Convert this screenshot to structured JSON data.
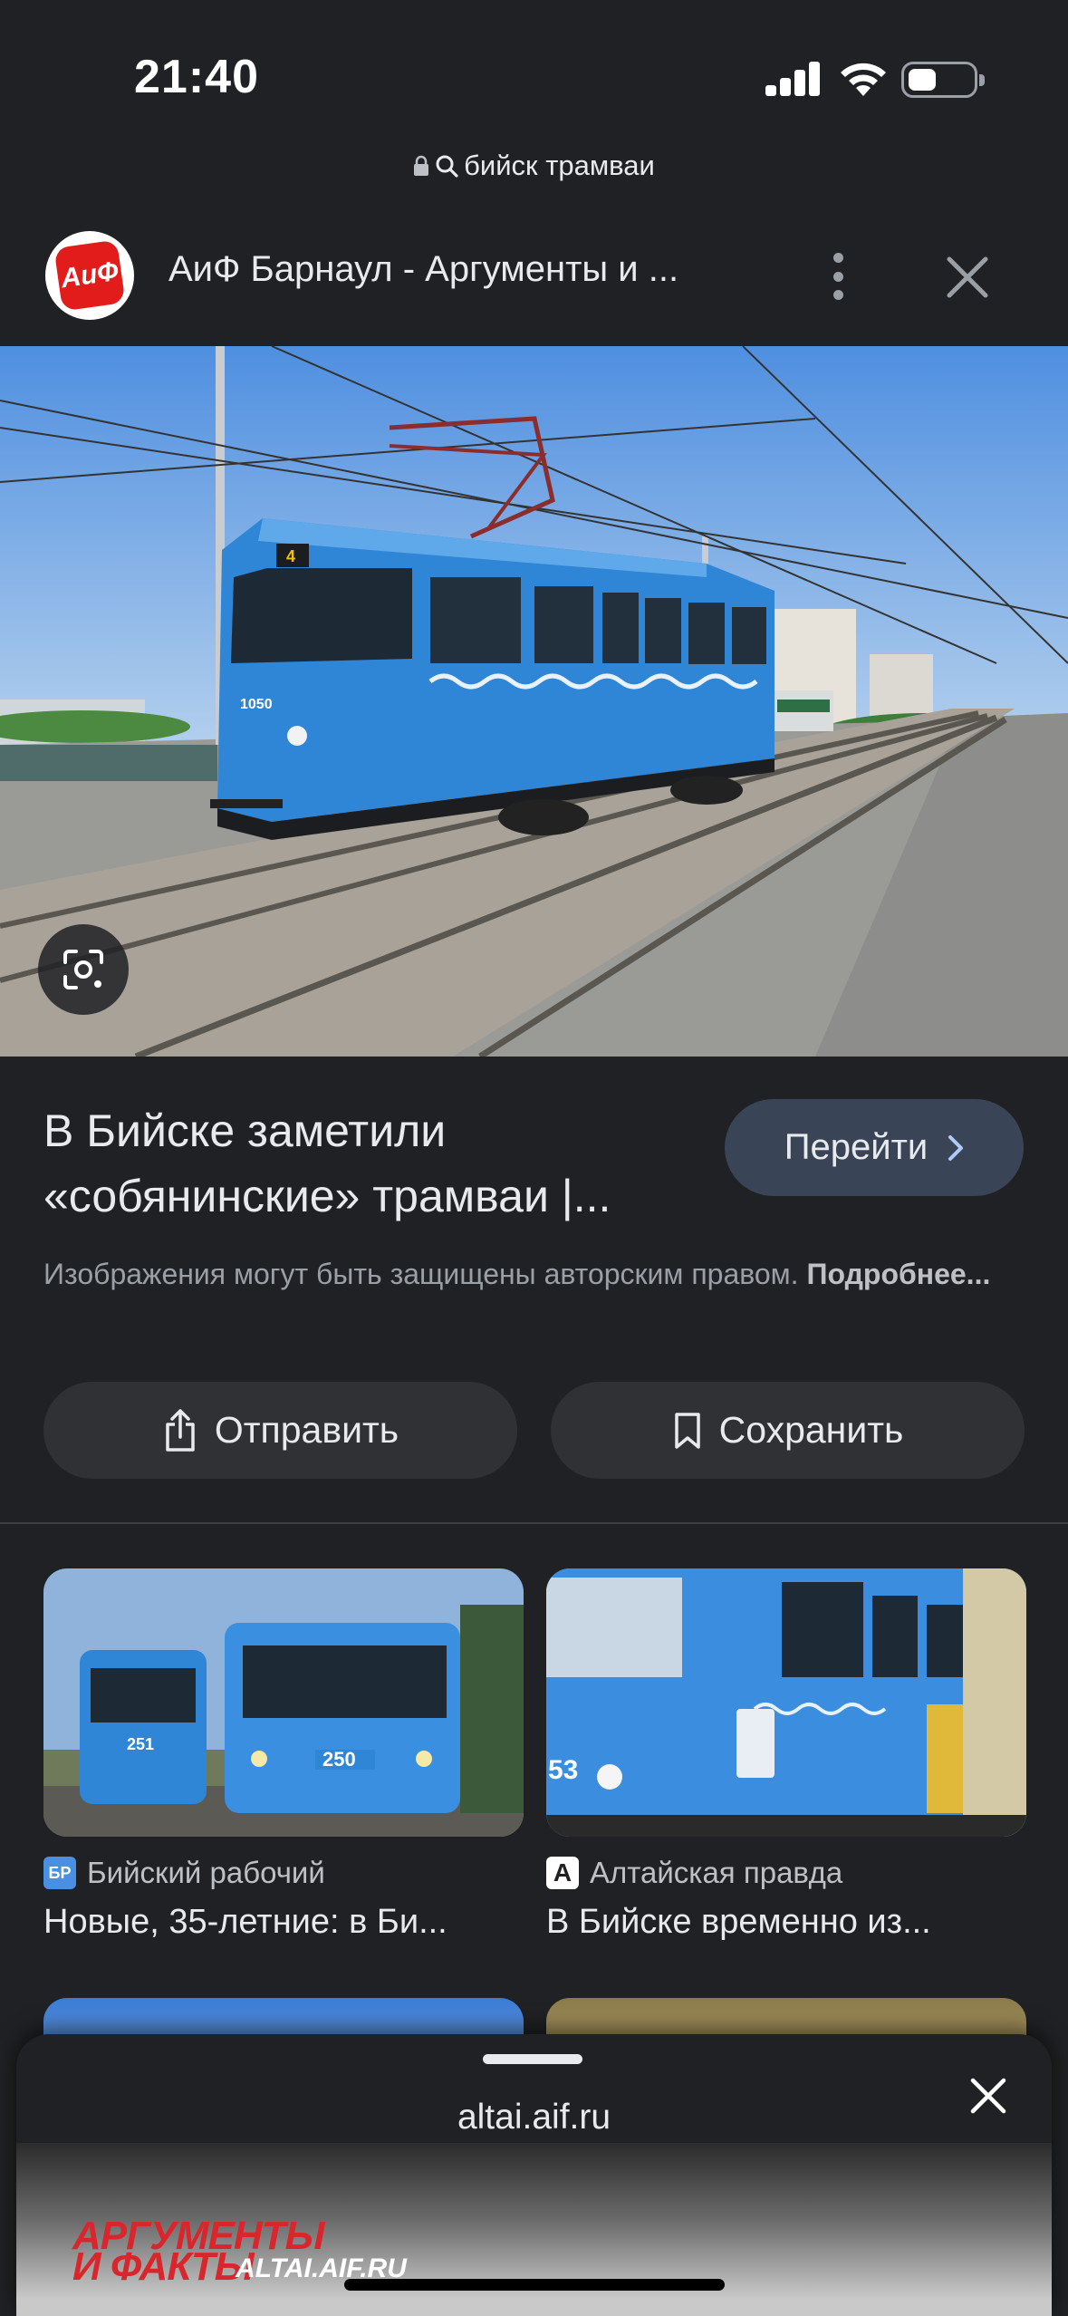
{
  "status_bar": {
    "time": "21:40"
  },
  "browser": {
    "query": "бийск трамваи"
  },
  "source": {
    "logo_text": "АиФ",
    "title": "АиФ Барнаул - Аргументы и ..."
  },
  "main_image": {
    "tram_number": "1050",
    "route": "4"
  },
  "result": {
    "title_line1": "В Бийске заметили",
    "title_line2": "«собянинские» трамваи |...",
    "visit_label": "Перейти",
    "copyright_text": "Изображения могут быть защищены авторским правом. ",
    "more_link": "Подробнее..."
  },
  "actions": {
    "send_label": "Отправить",
    "save_label": "Сохранить"
  },
  "related": [
    {
      "favicon": "БР",
      "source": "Бийский рабочий",
      "title": "Новые, 35-летние: в Би...",
      "tram_left": "251",
      "tram_right": "250"
    },
    {
      "favicon": "A",
      "source": "Алтайская правда",
      "title": "В Бийске временно из...",
      "tram_number": "53"
    }
  ],
  "sheet": {
    "domain": "altai.aif.ru",
    "brand_line1": "АРГУМЕНТЫ",
    "brand_line2": "И ФАКТЫ",
    "brand_domain": "ALTAI.AIF.RU"
  },
  "colors": {
    "background": "#202124",
    "button_bg": "#303134",
    "visit_button_bg": "#394457",
    "tram_blue": "#2f86d6",
    "brand_red": "#d9262c"
  },
  "icons": [
    "lock-icon",
    "search-icon",
    "more-vert-icon",
    "close-icon",
    "lens-icon",
    "chevron-right-icon",
    "share-icon",
    "bookmark-icon"
  ]
}
